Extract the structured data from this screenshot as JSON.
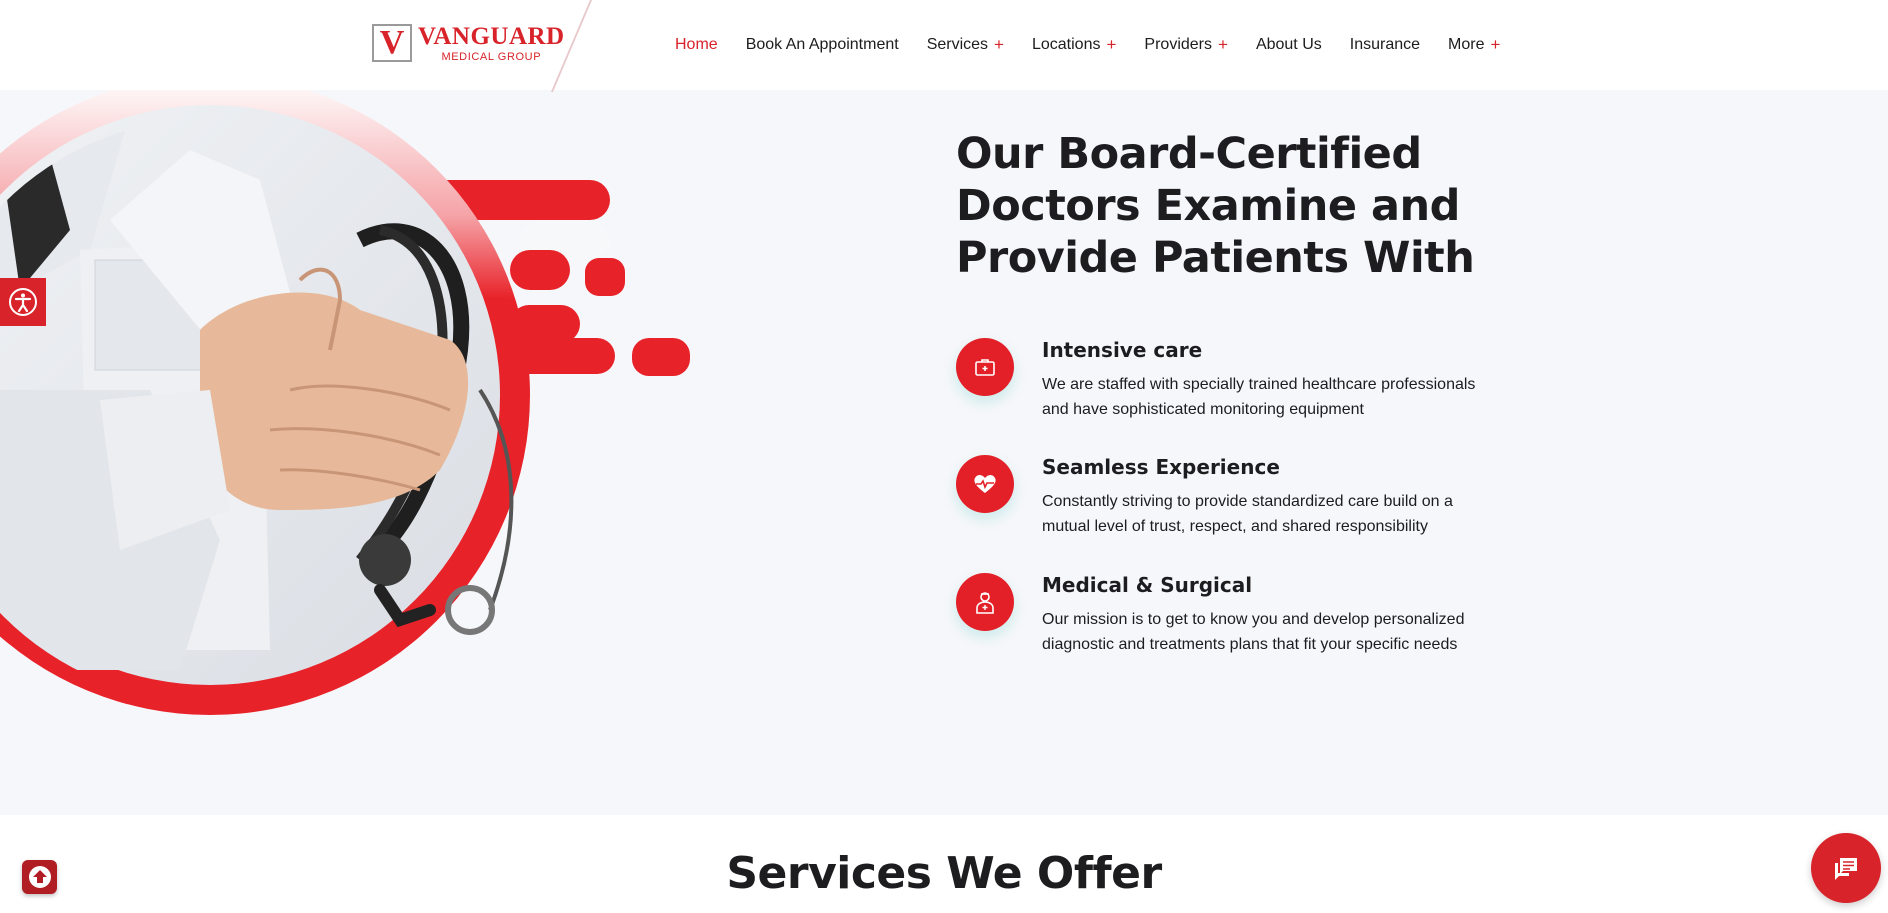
{
  "header": {
    "logo": {
      "letter": "V",
      "title": "VANGUARD",
      "subtitle": "MEDICAL GROUP"
    },
    "nav": [
      {
        "label": "Home",
        "active": true,
        "has_submenu": false
      },
      {
        "label": "Book An Appointment",
        "active": false,
        "has_submenu": false
      },
      {
        "label": "Services",
        "active": false,
        "has_submenu": true
      },
      {
        "label": "Locations",
        "active": false,
        "has_submenu": true
      },
      {
        "label": "Providers",
        "active": false,
        "has_submenu": true
      },
      {
        "label": "About Us",
        "active": false,
        "has_submenu": false
      },
      {
        "label": "Insurance",
        "active": false,
        "has_submenu": false
      },
      {
        "label": "More",
        "active": false,
        "has_submenu": true
      }
    ],
    "submenu_glyph": "+"
  },
  "hero": {
    "headline": "Our Board-Certified Doctors Examine and Provide Patients With",
    "features": [
      {
        "icon": "briefcase-medical-icon",
        "title": "Intensive care",
        "description": "We are staffed with specially trained healthcare professionals and have sophisticated monitoring equipment"
      },
      {
        "icon": "heart-pulse-icon",
        "title": "Seamless Experience",
        "description": "Constantly striving to provide standardized care build on a mutual level of trust, respect, and shared responsibility"
      },
      {
        "icon": "doctor-icon",
        "title": "Medical & Surgical",
        "description": "Our mission is to get to know you and develop personalized diagnostic and treatments plans that fit your specific needs"
      }
    ]
  },
  "services": {
    "title": "Services We Offer"
  },
  "widgets": {
    "accessibility_icon": "accessibility-icon",
    "scroll_top_icon": "arrow-up-icon",
    "chat_icon": "chat-icon"
  },
  "colors": {
    "accent": "#d8232a",
    "text": "#1d1d1f",
    "background": "#f6f7fa",
    "header": "#ffffff"
  }
}
